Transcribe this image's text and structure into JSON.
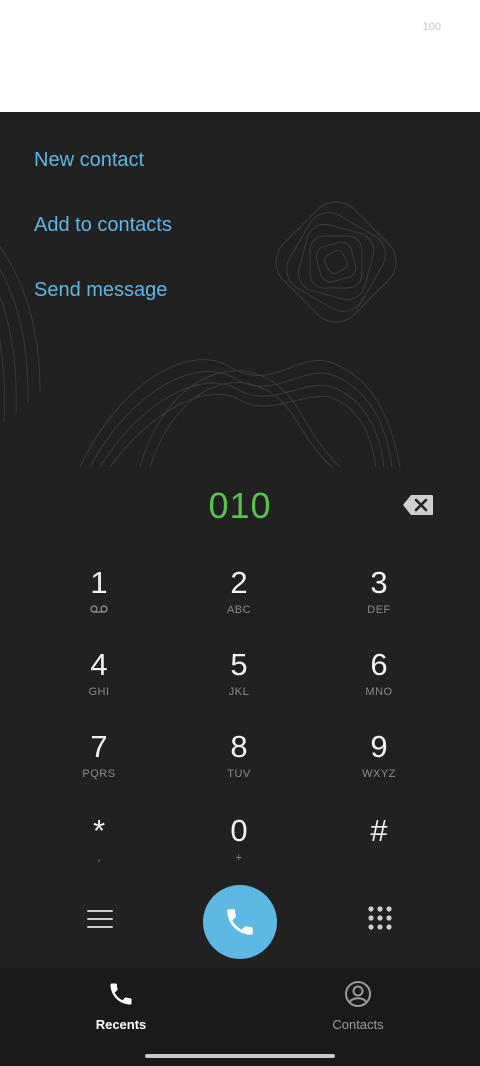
{
  "status_bar": {
    "battery": "100"
  },
  "actions": [
    {
      "label": "New contact"
    },
    {
      "label": "Add to contacts"
    },
    {
      "label": "Send message"
    }
  ],
  "dialer": {
    "number": "010",
    "keys": [
      {
        "digit": "1",
        "letters": ""
      },
      {
        "digit": "2",
        "letters": "ABC"
      },
      {
        "digit": "3",
        "letters": "DEF"
      },
      {
        "digit": "4",
        "letters": "GHI"
      },
      {
        "digit": "5",
        "letters": "JKL"
      },
      {
        "digit": "6",
        "letters": "MNO"
      },
      {
        "digit": "7",
        "letters": "PQRS"
      },
      {
        "digit": "8",
        "letters": "TUV"
      },
      {
        "digit": "9",
        "letters": "WXYZ"
      },
      {
        "digit": "*",
        "letters": ","
      },
      {
        "digit": "0",
        "letters": "+"
      },
      {
        "digit": "#",
        "letters": ""
      }
    ]
  },
  "bottom_nav": {
    "recents": "Recents",
    "contacts": "Contacts"
  },
  "colors": {
    "accent": "#5db7e6",
    "number": "#57c24d",
    "background": "#212121"
  }
}
